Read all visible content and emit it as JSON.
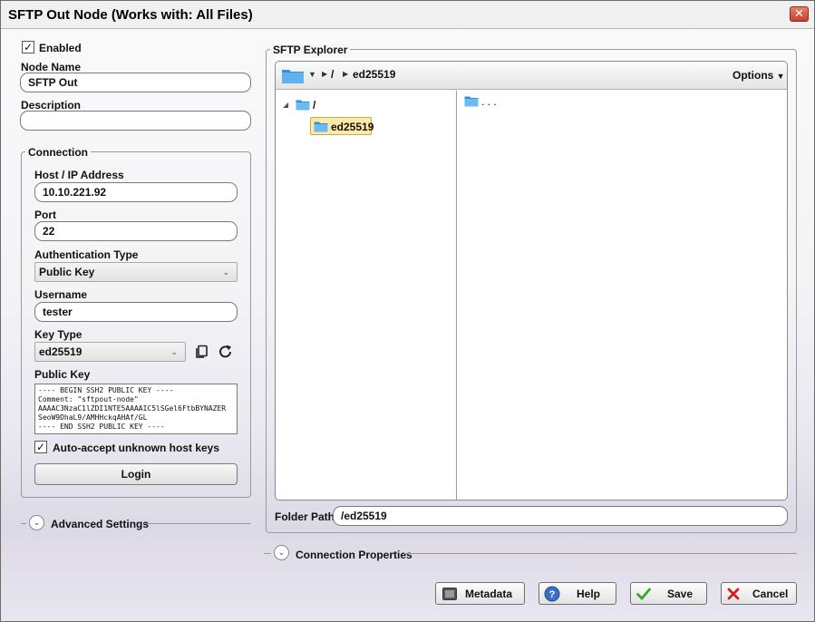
{
  "window": {
    "title": "SFTP Out Node  (Works with: All Files)",
    "close_glyph": "✕"
  },
  "left": {
    "enabled_label": "Enabled",
    "enabled_checked": true,
    "node_name_label": "Node Name",
    "node_name_value": "SFTP Out",
    "description_label": "Description",
    "description_value": "",
    "connection": {
      "group_label": "Connection",
      "host_label": "Host / IP Address",
      "host_value": "10.10.221.92",
      "port_label": "Port",
      "port_value": "22",
      "auth_type_label": "Authentication Type",
      "auth_type_value": "Public Key",
      "username_label": "Username",
      "username_value": "tester",
      "key_type_label": "Key Type",
      "key_type_value": "ed25519",
      "public_key_label": "Public Key",
      "public_key_value": "---- BEGIN SSH2 PUBLIC KEY ----\nComment: \"sftpout-node\"\nAAAAC3NzaC1lZDI1NTE5AAAAIC5lSGel6FtbBYNAZER\nSeoW9DhaL9/AMHHckqAHAf/GL\n---- END SSH2 PUBLIC KEY ----",
      "auto_accept_label": "Auto-accept unknown host keys",
      "auto_accept_checked": true,
      "login_label": "Login"
    },
    "advanced_settings_label": "Advanced Settings"
  },
  "explorer": {
    "group_label": "SFTP Explorer",
    "breadcrumb_root": "/",
    "breadcrumb_current": "ed25519",
    "options_label": "Options",
    "tree": [
      {
        "label": "/",
        "expanded": true
      },
      {
        "label": "ed25519",
        "selected": true
      }
    ],
    "file_list": [
      {
        "label": ". . ."
      }
    ],
    "folder_path_label": "Folder Path",
    "folder_path_value": "/ed25519"
  },
  "connection_properties_label": "Connection Properties",
  "footer": {
    "metadata_label": "Metadata",
    "help_label": "Help",
    "save_label": "Save",
    "cancel_label": "Cancel"
  },
  "colors": {
    "folder_blue": "#4aa3e8",
    "selection_bg": "#fde9a8",
    "save_green": "#3aa82a",
    "cancel_red": "#d11f1f"
  },
  "icons": {
    "copy": "copy-icon",
    "refresh": "refresh-icon",
    "folder": "folder-icon",
    "metadata": "metadata-icon",
    "help": "help-icon",
    "save": "checkmark-icon",
    "cancel": "x-icon"
  }
}
